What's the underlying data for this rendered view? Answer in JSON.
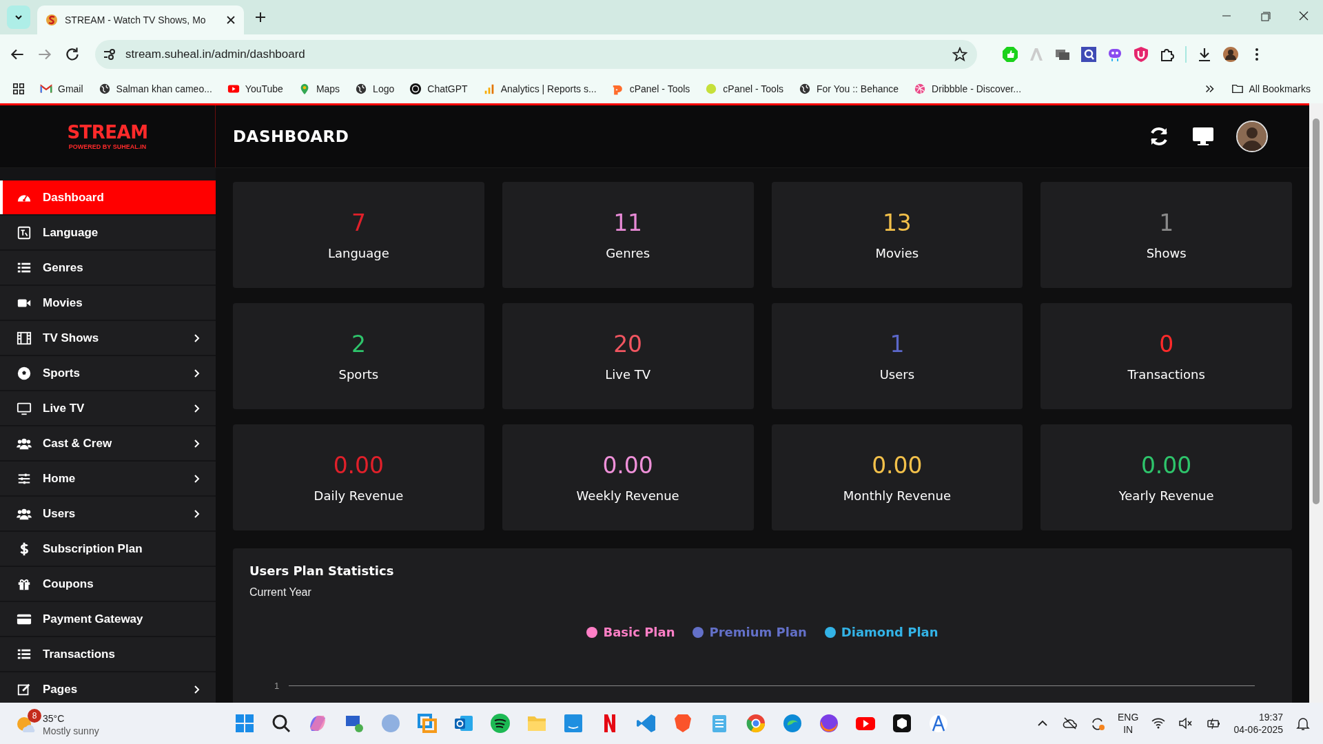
{
  "browser": {
    "tab_title": "STREAM - Watch TV Shows, Mo",
    "url": "stream.suheal.in/admin/dashboard",
    "bookmarks": [
      "Gmail",
      "Salman khan cameo...",
      "YouTube",
      "Maps",
      "Logo",
      "ChatGPT",
      "Analytics | Reports s...",
      "cPanel - Tools",
      "cPanel - Tools",
      "For You :: Behance",
      "Dribbble - Discover..."
    ],
    "all_bookmarks": "All Bookmarks"
  },
  "header": {
    "logo": "STREAM",
    "logo_tagline": "POWERED BY SUHEAL.IN",
    "title": "DASHBOARD"
  },
  "sidebar": {
    "items": [
      {
        "label": "Dashboard",
        "selected": true,
        "has_submenu": false
      },
      {
        "label": "Language",
        "selected": false,
        "has_submenu": false
      },
      {
        "label": "Genres",
        "selected": false,
        "has_submenu": false
      },
      {
        "label": "Movies",
        "selected": false,
        "has_submenu": false
      },
      {
        "label": "TV Shows",
        "selected": false,
        "has_submenu": true
      },
      {
        "label": "Sports",
        "selected": false,
        "has_submenu": true
      },
      {
        "label": "Live TV",
        "selected": false,
        "has_submenu": true
      },
      {
        "label": "Cast & Crew",
        "selected": false,
        "has_submenu": true
      },
      {
        "label": "Home",
        "selected": false,
        "has_submenu": true
      },
      {
        "label": "Users",
        "selected": false,
        "has_submenu": true
      },
      {
        "label": "Subscription Plan",
        "selected": false,
        "has_submenu": false
      },
      {
        "label": "Coupons",
        "selected": false,
        "has_submenu": false
      },
      {
        "label": "Payment Gateway",
        "selected": false,
        "has_submenu": false
      },
      {
        "label": "Transactions",
        "selected": false,
        "has_submenu": false
      },
      {
        "label": "Pages",
        "selected": false,
        "has_submenu": true
      }
    ]
  },
  "cards": [
    {
      "value": "7",
      "label": "Language",
      "color": "#e0202a"
    },
    {
      "value": "11",
      "label": "Genres",
      "color": "#e88ad6"
    },
    {
      "value": "13",
      "label": "Movies",
      "color": "#f2c04a"
    },
    {
      "value": "1",
      "label": "Shows",
      "color": "#8a8a8a"
    },
    {
      "value": "2",
      "label": "Sports",
      "color": "#2ec46b"
    },
    {
      "value": "20",
      "label": "Live TV",
      "color": "#f05560"
    },
    {
      "value": "1",
      "label": "Users",
      "color": "#5b67c9"
    },
    {
      "value": "0",
      "label": "Transactions",
      "color": "#ff2a2a"
    },
    {
      "value": "0.00",
      "label": "Daily Revenue",
      "color": "#e0202a"
    },
    {
      "value": "0.00",
      "label": "Weekly Revenue",
      "color": "#ee90d8"
    },
    {
      "value": "0.00",
      "label": "Monthly Revenue",
      "color": "#f2c04a"
    },
    {
      "value": "0.00",
      "label": "Yearly Revenue",
      "color": "#2ec46b"
    }
  ],
  "plan_statistics": {
    "title": "Users Plan Statistics",
    "subtitle": "Current Year",
    "legend": [
      {
        "label": "Basic Plan",
        "color": "#ff7fc6"
      },
      {
        "label": "Premium Plan",
        "color": "#6370c8"
      },
      {
        "label": "Diamond Plan",
        "color": "#33b3e6"
      }
    ],
    "y_tick_labels": [
      "1"
    ]
  },
  "taskbar": {
    "weather_badge": "8",
    "temperature": "35°C",
    "condition": "Mostly sunny",
    "language": "ENG",
    "region": "IN",
    "time": "19:37",
    "date": "04-06-2025"
  }
}
